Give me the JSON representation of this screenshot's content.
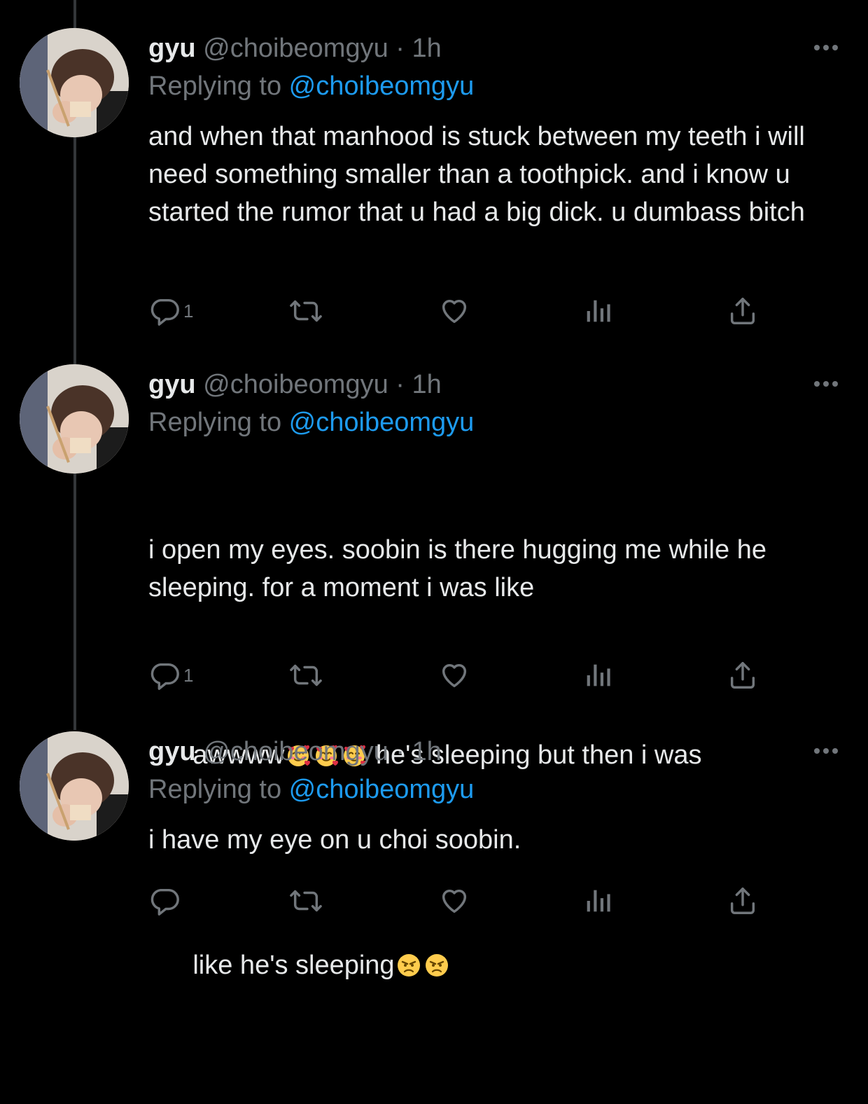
{
  "theme": {
    "background": "#000000",
    "text": "#e7e9ea",
    "muted": "#71767b",
    "accent": "#1d9bf0",
    "thread_line": "#333639"
  },
  "tweets": [
    {
      "display_name": "gyu",
      "handle": "@choibeomgyu",
      "separator": "·",
      "time": "1h",
      "replying_prefix": "Replying to ",
      "replying_to": "@choibeomgyu",
      "text": "and when that manhood is stuck between my teeth i will need something smaller than a toothpick. and i know u started the rumor that u had a big dick. u dumbass bitch",
      "reply_count": "1",
      "icons": [
        "reply-icon",
        "retweet-icon",
        "like-icon",
        "views-icon",
        "share-icon",
        "more-icon"
      ]
    },
    {
      "display_name": "gyu",
      "handle": "@choibeomgyu",
      "separator": "·",
      "time": "1h",
      "replying_prefix": "Replying to ",
      "replying_to": "@choibeomgyu",
      "text_part1": "i open my eyes. soobin is there hugging me while he sleeping. for a moment i was like",
      "text_part2": "awwww",
      "text_part3": " he's sleeping but then i was",
      "text_part4": "like he's sleeping",
      "emojis": [
        "smiling-face-with-hearts",
        "angry-face"
      ],
      "reply_count": "1",
      "icons": [
        "reply-icon",
        "retweet-icon",
        "like-icon",
        "views-icon",
        "share-icon",
        "more-icon"
      ]
    },
    {
      "display_name": "gyu",
      "handle": "@choibeomgyu",
      "separator": "·",
      "time": "1h",
      "replying_prefix": "Replying to ",
      "replying_to": "@choibeomgyu",
      "text": "i have my eye on u choi soobin.",
      "icons": [
        "reply-icon",
        "retweet-icon",
        "like-icon",
        "views-icon",
        "share-icon",
        "more-icon"
      ]
    }
  ]
}
